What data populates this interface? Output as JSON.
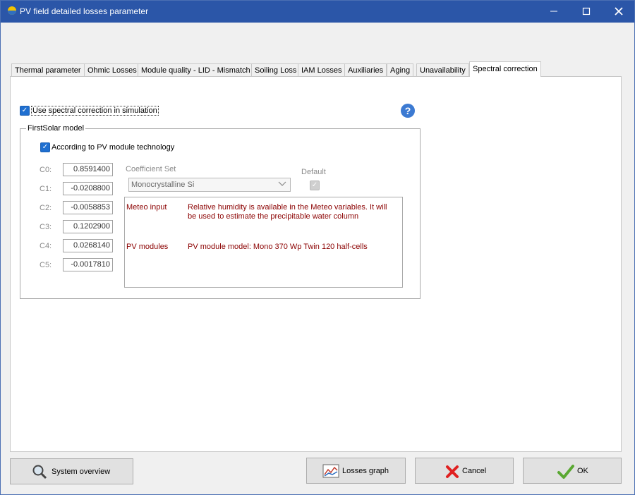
{
  "window": {
    "title": "PV field detailed losses parameter"
  },
  "tabs": [
    {
      "label": "Thermal parameter"
    },
    {
      "label": "Ohmic Losses"
    },
    {
      "label": "Module quality - LID - Mismatch"
    },
    {
      "label": "Soiling Loss"
    },
    {
      "label": "IAM Losses"
    },
    {
      "label": "Auxiliaries"
    },
    {
      "label": "Aging"
    },
    {
      "label": "Unavailability"
    },
    {
      "label": "Spectral correction"
    }
  ],
  "active_tab": "Spectral correction",
  "spectral": {
    "use_label": "Use spectral correction in simulation",
    "use_checked": true,
    "group_title": "FirstSolar model",
    "according_label": "According to PV module technology",
    "according_checked": true,
    "coefficients": [
      {
        "label": "C0:",
        "value": "0.8591400"
      },
      {
        "label": "C1:",
        "value": "-0.0208800"
      },
      {
        "label": "C2:",
        "value": "-0.0058853"
      },
      {
        "label": "C3:",
        "value": "0.1202900"
      },
      {
        "label": "C4:",
        "value": "0.0268140"
      },
      {
        "label": "C5:",
        "value": "-0.0017810"
      }
    ],
    "coefficient_set_label": "Coefficient Set",
    "coefficient_set_value": "Monocrystalline Si",
    "default_label": "Default",
    "default_checked": true,
    "info": {
      "meteo_key": "Meteo input",
      "meteo_text": "Relative humidity is available in the Meteo variables. It will be used to estimate the precipitable water column",
      "pv_key": "PV modules",
      "pv_text": "PV module model: Mono 370 Wp Twin 120 half-cells"
    }
  },
  "buttons": {
    "system_overview": "System overview",
    "losses_graph": "Losses graph",
    "cancel": "Cancel",
    "ok": "OK"
  },
  "colors": {
    "titlebar": "#2b56a8",
    "checkbox": "#1f6fd0",
    "info_text": "#8b0000"
  }
}
